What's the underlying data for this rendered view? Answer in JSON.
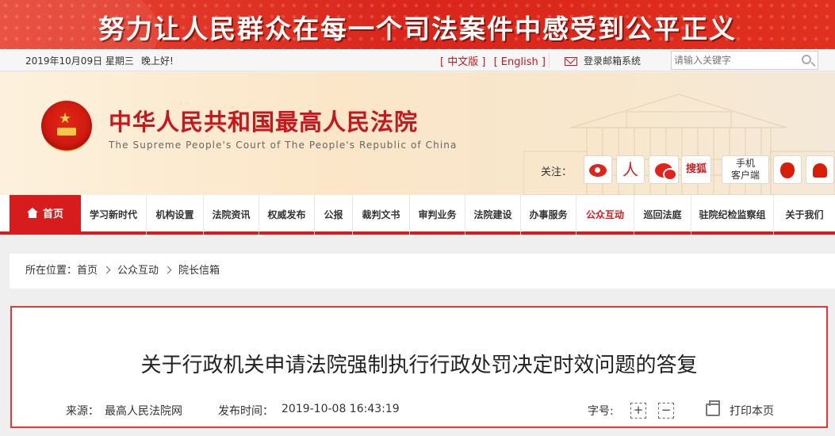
{
  "banner": {
    "slogan": "努力让人民群众在每一个司法案件中感受到公平正义"
  },
  "topbar": {
    "date": "2019年10月09日 星期三",
    "greeting": "晚上好!",
    "lang_cn": "[ 中文版 ]",
    "lang_en": "[ English ]",
    "mail_label": "登录邮箱系统"
  },
  "search": {
    "placeholder": "请输入关键字"
  },
  "header": {
    "title": "中华人民共和国最高人民法院",
    "subtitle": "The Supreme People's Court of The People's Republic of China",
    "follow_label": "关注：",
    "sohu_label": "搜狐",
    "mobile_label_1": "手机",
    "mobile_label_2": "客户端",
    "renmin_glyph": "人"
  },
  "nav": {
    "home": "首页",
    "items": [
      "学习新时代",
      "机构设置",
      "法院资讯",
      "权威发布",
      "公报",
      "裁判文书",
      "审判业务",
      "法院建设",
      "办事服务",
      "公众互动",
      "巡回法庭",
      "驻院纪检监察组",
      "关于我们"
    ]
  },
  "breadcrumb": {
    "label": "所在位置：",
    "items": [
      "首页",
      "公众互动",
      "院长信箱"
    ]
  },
  "article": {
    "title": "关于行政机关申请法院强制执行行政处罚决定时效问题的答复",
    "source_label": "来源：",
    "source": "最高人民法院网",
    "time_label": "发布时间：",
    "time": "2019-10-08 16:43:19",
    "font_label": "字号:",
    "font_plus": "+",
    "font_minus": "−",
    "print": "打印本页"
  },
  "colors": {
    "brand_red": "#d61c1c",
    "header_bg": "#fbe6c8"
  }
}
